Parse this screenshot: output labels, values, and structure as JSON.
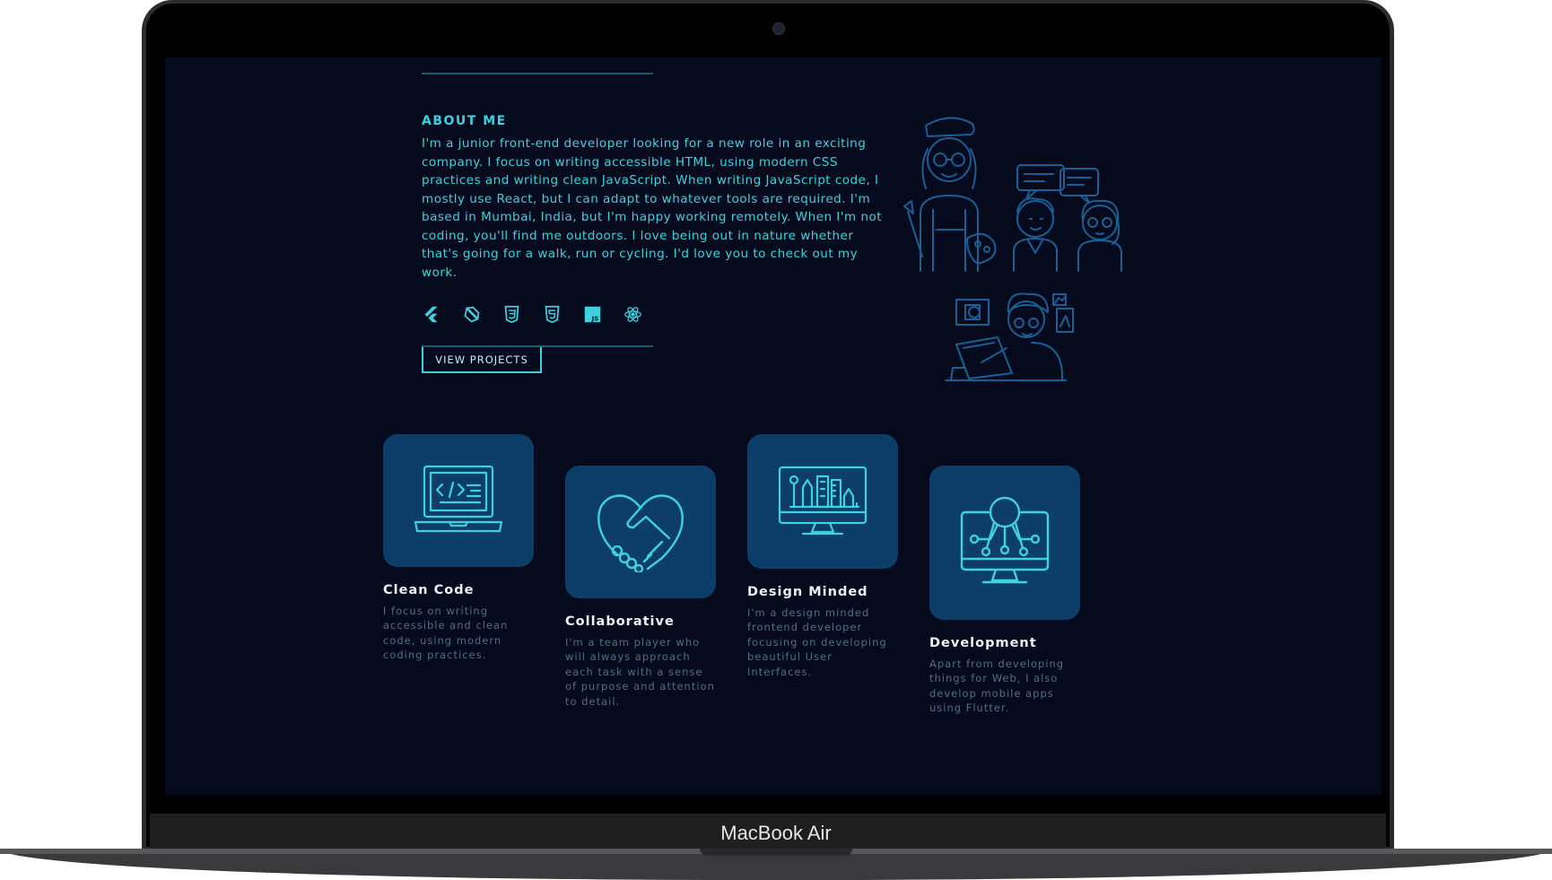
{
  "device": {
    "brand_label": "MacBook Air"
  },
  "about": {
    "title": "ABOUT ME",
    "text": "I'm a junior front-end developer looking for a new role in an exciting company. I focus on writing accessible HTML, using modern CSS practices and writing clean JavaScript. When writing JavaScript code, I mostly use React, but I can adapt to whatever tools are required. I'm based in Mumbai, India, but I'm happy working remotely. When I'm not coding, you'll find me outdoors. I love being out in nature whether that's going for a walk, run or cycling. I'd love you to check out my work.",
    "tech_icons": [
      "flutter-icon",
      "dart-icon",
      "css3-icon",
      "html5-icon",
      "javascript-icon",
      "react-icon"
    ],
    "button_label": "VIEW PROJECTS"
  },
  "features": [
    {
      "title": "Clean Code",
      "desc": "I focus on writing accessible and clean code, using modern coding practices.",
      "icon": "laptop-code-icon"
    },
    {
      "title": "Collaborative",
      "desc": "I'm a team player who will always approach each task with a sense of purpose and attention to detail.",
      "icon": "handshake-heart-icon"
    },
    {
      "title": "Design Minded",
      "desc": "I'm a design minded frontend developer focusing on developing beautiful User Interfaces.",
      "icon": "design-monitor-icon"
    },
    {
      "title": "Development",
      "desc": "Apart from developing things for Web, I also develop mobile apps using Flutter.",
      "icon": "network-monitor-icon"
    }
  ],
  "colors": {
    "accent": "#3fd1e0",
    "background": "#050a1c",
    "tile": "#0d3e69",
    "muted_text": "#4f6f86"
  }
}
